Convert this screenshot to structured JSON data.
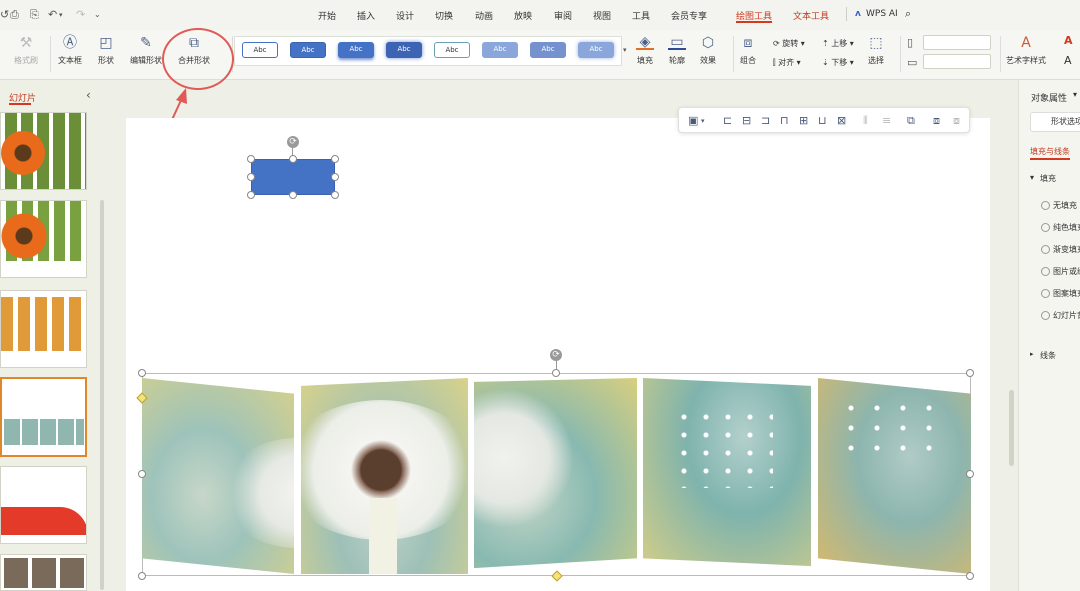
{
  "menu": {
    "tabs": [
      "开始",
      "插入",
      "设计",
      "切换",
      "动画",
      "放映",
      "审阅",
      "视图",
      "工具",
      "会员专享",
      "绘图工具",
      "文本工具"
    ],
    "active_tab": "绘图工具",
    "wps_ai": "WPS AI"
  },
  "ribbon": {
    "format_painter": "格式刷",
    "textbox": "文本框",
    "shape": "形状",
    "edit_shape": "编辑形状",
    "merge_shape": "合并形状",
    "style_sample": "Abc",
    "fill": "填充",
    "outline": "轮廓",
    "effect": "效果",
    "group": "组合",
    "rotate": "旋转",
    "align": "对齐",
    "bring_up": "上移",
    "send_down": "下移",
    "select": "选择",
    "art_text_style": "艺术字样式"
  },
  "left_panel": {
    "tab_label": "幻灯片",
    "collapse_icon": "chevron-left-icon"
  },
  "right_panel": {
    "title": "对象属性",
    "shape_options_tab": "形状选项",
    "fill_and_line": "填充与线条",
    "fill_section": "填充",
    "fill_options": [
      "无填充",
      "纯色填充",
      "渐变填充",
      "图片或纹理填充",
      "图案填充",
      "幻灯片背景填充"
    ],
    "line_section": "线条"
  },
  "colors": {
    "accent_red": "#d4381e",
    "shape_blue": "#4472c4",
    "annotation_red": "#e05a56"
  }
}
